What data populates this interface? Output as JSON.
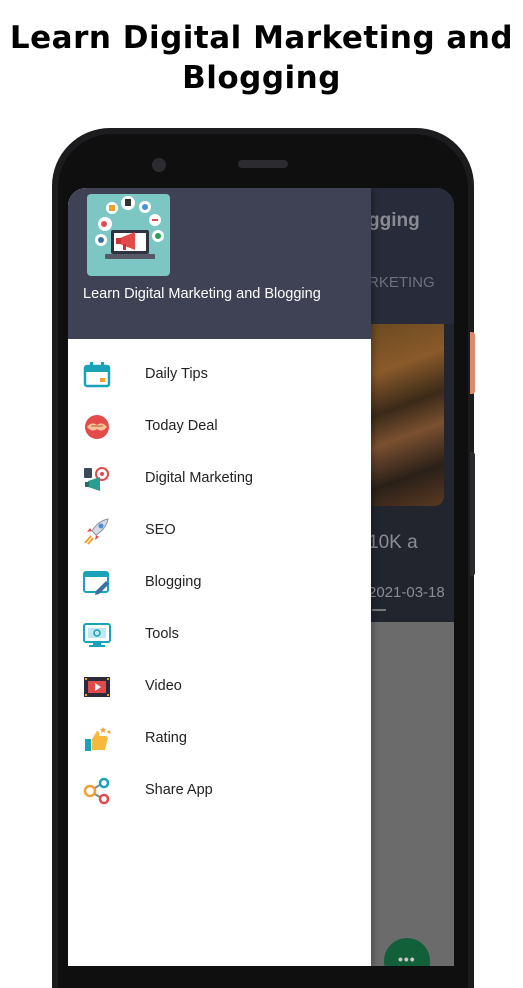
{
  "headline": {
    "line1": "Learn Digital Marketing and",
    "line2": "Blogging"
  },
  "background_app": {
    "toolbar_title_fragment": "gging",
    "tab_fragment": "RKETING",
    "card_text_fragment": "10K a",
    "card_date_fragment": "2021-03-18",
    "fab_glyph": "•••",
    "fab_tail": "!"
  },
  "drawer": {
    "app_name": "Learn Digital Marketing and Blogging",
    "logo_icon": "digital-marketing-laptop-megaphone-icon",
    "header_color": "#3f4254",
    "items": [
      {
        "label": "Daily Tips",
        "icon": "calendar-icon"
      },
      {
        "label": "Today Deal",
        "icon": "handshake-icon"
      },
      {
        "label": "Digital Marketing",
        "icon": "megaphone-target-icon"
      },
      {
        "label": "SEO",
        "icon": "rocket-icon"
      },
      {
        "label": "Blogging",
        "icon": "blog-edit-icon"
      },
      {
        "label": "Tools",
        "icon": "monitor-tools-icon"
      },
      {
        "label": "Video",
        "icon": "video-film-icon"
      },
      {
        "label": "Rating",
        "icon": "thumbs-up-stars-icon"
      },
      {
        "label": "Share App",
        "icon": "share-nodes-icon"
      }
    ]
  }
}
